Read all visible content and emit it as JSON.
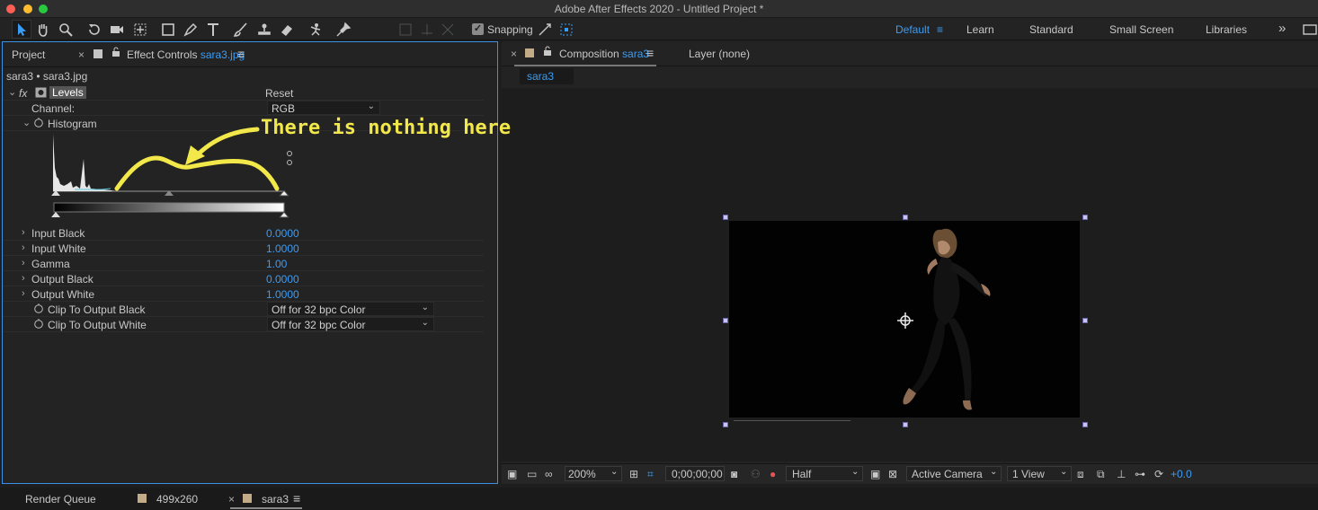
{
  "window": {
    "title": "Adobe After Effects 2020 - Untitled Project *"
  },
  "toolbar": {
    "snapping_label": "Snapping",
    "snapping_checked": true,
    "workspaces": [
      "Default",
      "Learn",
      "Standard",
      "Small Screen",
      "Libraries"
    ],
    "active_workspace": "Default"
  },
  "effect_panel": {
    "project_tab": "Project",
    "tab_prefix": "Effect Controls",
    "tab_layer": "sara3.jpg",
    "breadcrumb": "sara3 • sara3.jpg",
    "fx_label": "fx",
    "effect_name": "Levels",
    "reset_label": "Reset",
    "channel_label": "Channel:",
    "channel_value": "RGB",
    "histogram_label": "Histogram",
    "properties": [
      {
        "label": "Input Black",
        "value": "0.0000"
      },
      {
        "label": "Input White",
        "value": "1.0000"
      },
      {
        "label": "Gamma",
        "value": "1.00"
      },
      {
        "label": "Output Black",
        "value": "0.0000"
      },
      {
        "label": "Output White",
        "value": "1.0000"
      }
    ],
    "clip_black_label": "Clip To Output Black",
    "clip_black_value": "Off for 32 bpc Color",
    "clip_white_label": "Clip To Output White",
    "clip_white_value": "Off for 32 bpc Color"
  },
  "annotation": {
    "text": "There is nothing here",
    "color": "#f2e84a"
  },
  "comp_panel": {
    "tab_prefix": "Composition",
    "tab_comp": "sara3",
    "layer_tab": "Layer (none)",
    "comp_chip": "sara3",
    "zoom": "200%",
    "timecode": "0;00;00;00",
    "resolution": "Half",
    "camera": "Active Camera",
    "views": "1 View",
    "exposure": "+0.0"
  },
  "bottom_tabs": {
    "render_queue": "Render Queue",
    "comp1": "499x260",
    "comp2": "sara3"
  },
  "colors": {
    "accent": "#3b9cf5",
    "panel_focus": "#3b8fe5",
    "label_swatch": "#c4ab87"
  }
}
